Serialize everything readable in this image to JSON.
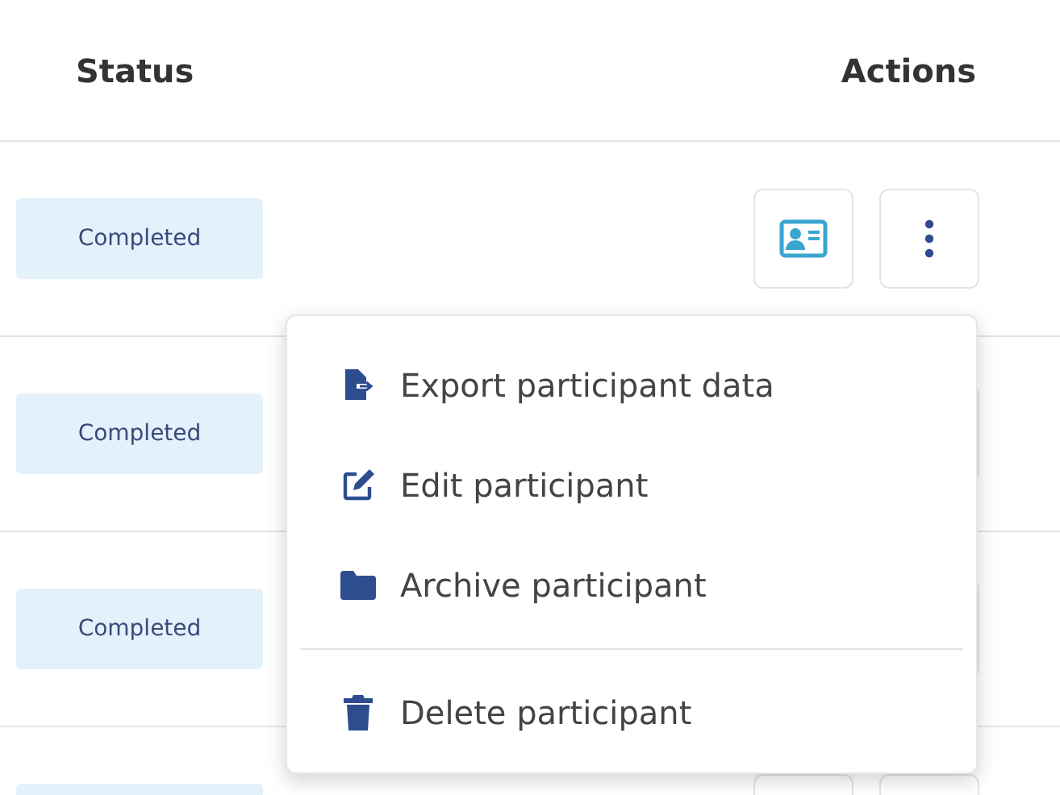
{
  "table": {
    "columns": [
      "Status",
      "Actions"
    ],
    "rows": [
      {
        "status": "Completed"
      },
      {
        "status": "Completed"
      },
      {
        "status": "Completed"
      },
      {}
    ]
  },
  "menu": {
    "items": [
      {
        "kind": "export",
        "label": "Export participant data"
      },
      {
        "kind": "edit",
        "label": "Edit participant"
      },
      {
        "kind": "archive",
        "label": "Archive participant"
      },
      {
        "kind": "divider"
      },
      {
        "kind": "delete",
        "label": "Delete participant"
      }
    ]
  }
}
